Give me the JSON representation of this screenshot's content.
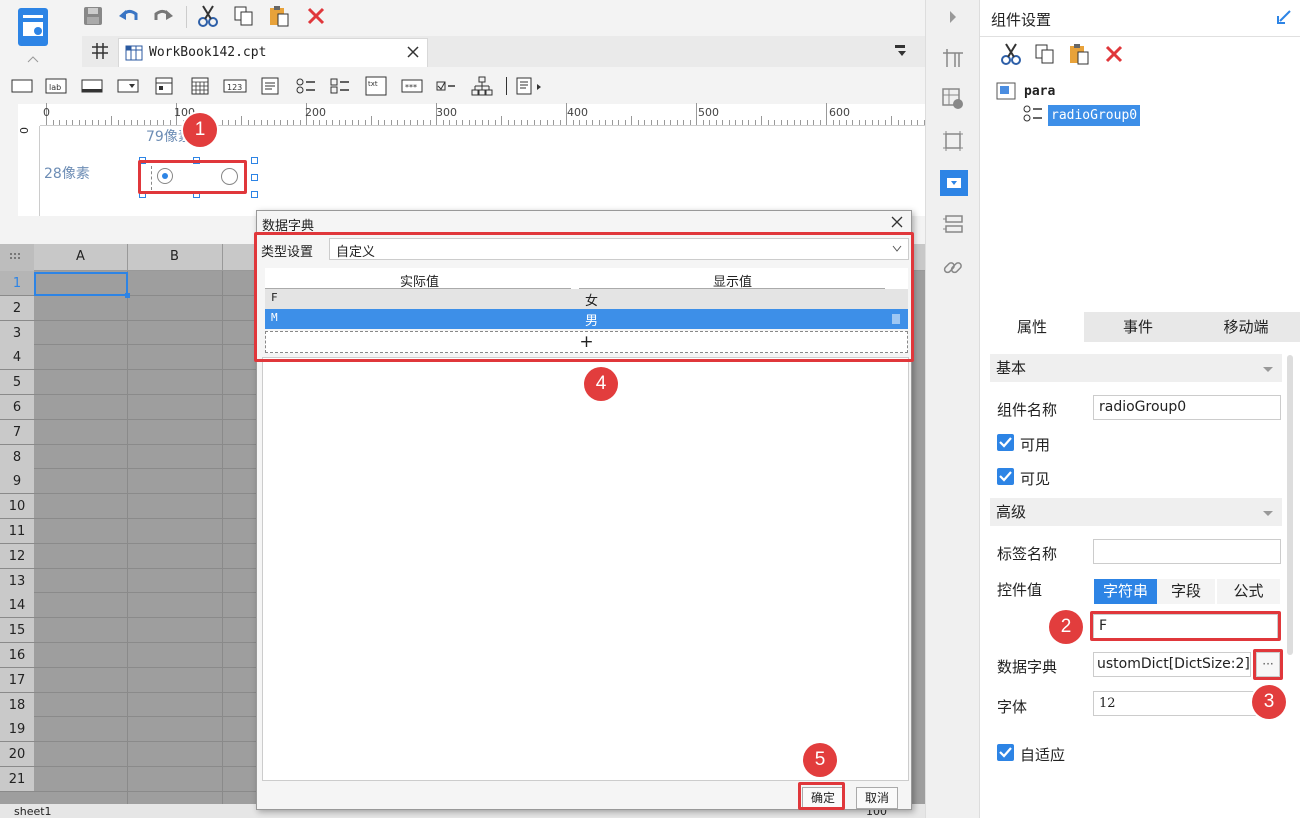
{
  "toolbar": {
    "save": "save-icon",
    "undo": "undo-icon",
    "redo": "redo-icon",
    "cut": "cut-icon",
    "copy": "copy-icon",
    "paste": "paste-icon",
    "delete": "delete-icon"
  },
  "tab": {
    "title": "WorkBook142.cpt"
  },
  "ruler": {
    "labels": [
      "0",
      "100",
      "200",
      "300",
      "400",
      "500",
      "600"
    ]
  },
  "canvas": {
    "width_label": "79像素",
    "height_label": "28像素"
  },
  "sheet": {
    "columns": [
      "A",
      "B"
    ],
    "rows": [
      "1",
      "2",
      "3",
      "4",
      "5",
      "6",
      "7",
      "8",
      "9",
      "10",
      "11",
      "12",
      "13",
      "14",
      "15",
      "16",
      "17",
      "18",
      "19",
      "20",
      "21"
    ],
    "tab": "sheet1",
    "zoom": "100"
  },
  "dialog": {
    "title": "数据字典",
    "type_label": "类型设置",
    "type_value": "自定义",
    "col_actual": "实际值",
    "col_display": "显示值",
    "rows": [
      {
        "actual": "F",
        "display": "女"
      },
      {
        "actual": "M",
        "display": "男"
      }
    ],
    "add": "+",
    "ok": "确定",
    "cancel": "取消"
  },
  "panel": {
    "title": "组件设置",
    "tree": {
      "root": "para",
      "child": "radioGroup0"
    },
    "tabs": [
      "属性",
      "事件",
      "移动端"
    ],
    "basic": "基本",
    "name_label": "组件名称",
    "name_value": "radioGroup0",
    "enabled": "可用",
    "visible": "可见",
    "advanced": "高级",
    "tag_label": "标签名称",
    "tag_value": "",
    "value_label": "控件值",
    "value_modes": [
      "字符串",
      "字段",
      "公式"
    ],
    "value": "F",
    "dict_label": "数据字典",
    "dict_value": "ustomDict[DictSize:2]",
    "dict_btn": "···",
    "font_label": "字体",
    "font_value": "12",
    "adaptive": "自适应"
  },
  "badges": [
    "1",
    "2",
    "3",
    "4",
    "5"
  ],
  "colors": {
    "accent": "#2d84e5",
    "red": "#e0373b",
    "selected": "#3d8fe8"
  }
}
